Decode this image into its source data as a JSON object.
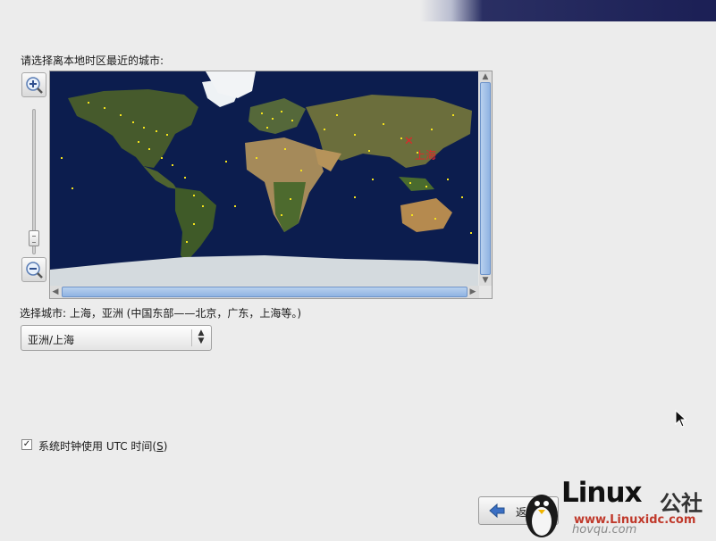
{
  "prompt": "请选择离本地时区最近的城市:",
  "map": {
    "selected_city_label": "上海",
    "zoom_in_icon": "zoom-in-icon",
    "zoom_out_icon": "zoom-out-icon"
  },
  "selected_city_text": "选择城市: 上海，亚洲 (中国东部——北京，广东，上海等。)",
  "timezone_select": {
    "value": "亚洲/上海"
  },
  "utc_checkbox": {
    "checked": true,
    "label_main": "系统时钟使用 UTC 时间(",
    "label_key": "S",
    "label_end": ")"
  },
  "buttons": {
    "back_label": "返"
  },
  "watermark": {
    "logo_text": "Linux",
    "logo_suffix": "公社",
    "url": "www.Linuxidc.com",
    "url2": "hovqu.com"
  },
  "colors": {
    "map_ocean": "#0c1d4e",
    "city_dot": "#f3e21c",
    "selected": "#e0262a",
    "scroll_accent": "#8fb3e2"
  }
}
